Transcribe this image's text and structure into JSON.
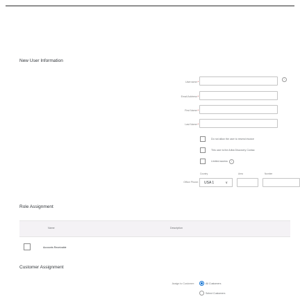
{
  "form": {
    "title": "New User Information",
    "username_label": "Username:",
    "email_label": "Email Address:",
    "first_name_label": "First Name:",
    "last_name_label": "Last Name:",
    "required_mark": "*",
    "info_glyph": "i",
    "cb_no_resend": "Do not allow the user to resend invoice",
    "cb_ariba_contact": "This user is the Ariba Discovery Contac",
    "cb_limited": "Limited access",
    "office_phone_label": "Office Phone:",
    "country_label": "Country",
    "area_label": "Area",
    "number_label": "Number",
    "country_value": "USA 1",
    "chevron": "∨"
  },
  "role": {
    "title": "Role Assignment",
    "col_name": "Name",
    "col_description": "Description",
    "rows": [
      {
        "name": "Accounts Receivable",
        "checked": false
      }
    ]
  },
  "customer": {
    "title": "Customer Assignment",
    "assign_label": "Assign to Customer:",
    "options": [
      {
        "label": "All Customers",
        "selected": true
      },
      {
        "label": "Select Customers",
        "selected": false
      }
    ]
  },
  "colors": {
    "accent": "#0a6ed1",
    "required": "#bb0000",
    "table_header": "#f4f2f5"
  }
}
